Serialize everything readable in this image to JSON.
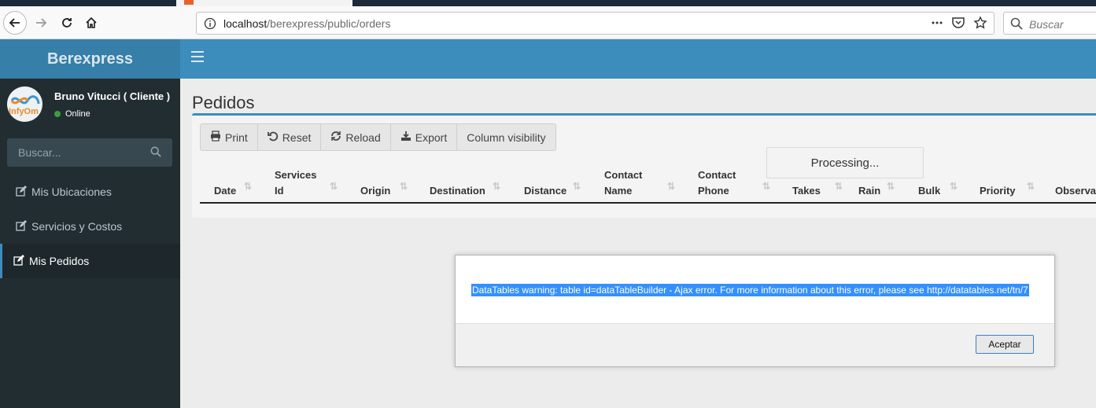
{
  "browser": {
    "url_host": "localhost",
    "url_path": "/berexpress/public/orders",
    "search_placeholder": "Buscar"
  },
  "sidebar": {
    "app_name": "Berexpress",
    "user_name": "Bruno Vitucci ( Cliente )",
    "user_status": "Online",
    "avatar_text": "InfyOm",
    "search_placeholder": "Buscar...",
    "items": [
      {
        "label": "Mis Ubicaciones",
        "icon": "edit-icon"
      },
      {
        "label": "Servicios y Costos",
        "icon": "edit-icon"
      },
      {
        "label": "Mis Pedidos",
        "icon": "edit-icon",
        "active": true
      }
    ]
  },
  "page": {
    "title": "Pedidos",
    "buttons": {
      "print": "Print",
      "reset": "Reset",
      "reload": "Reload",
      "export": "Export",
      "column_visibility": "Column visibility"
    },
    "columns": {
      "date": "Date",
      "services_id_1": "Services",
      "services_id_2": "Id",
      "origin": "Origin",
      "destination": "Destination",
      "distance": "Distance",
      "contact_name_1": "Contact",
      "contact_name_2": "Name",
      "contact_phone_1": "Contact",
      "contact_phone_2": "Phone",
      "takes": "Takes",
      "rain": "Rain",
      "bulk": "Bulk",
      "priority": "Priority",
      "observations": "Observations"
    },
    "processing": "Processing..."
  },
  "dialog": {
    "message": "DataTables warning: table id=dataTableBuilder - Ajax error. For more information about this error, please see http://datatables.net/tn/7",
    "ok_label": "Aceptar"
  },
  "colors": {
    "header": "#3c8dbc",
    "logo_bg": "#367fa9",
    "sidebar": "#222d32",
    "selection": "#3390ff"
  }
}
